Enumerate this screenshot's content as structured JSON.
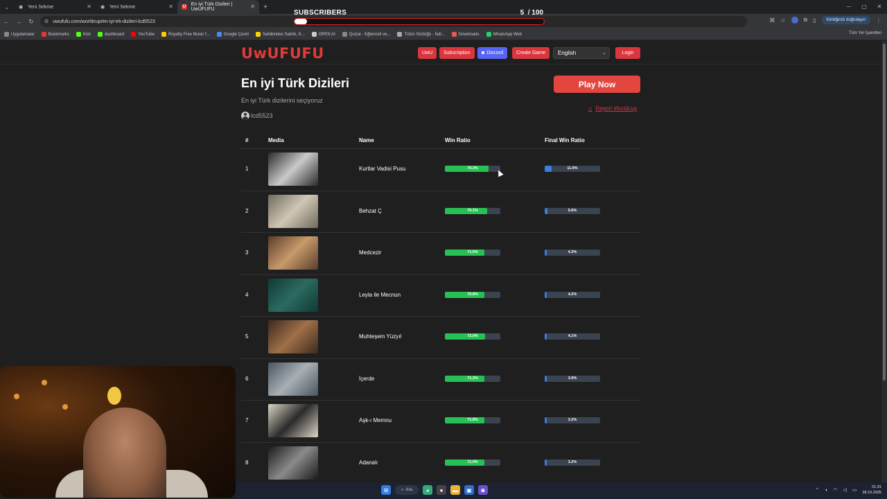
{
  "browser": {
    "tabs": [
      {
        "label": "Yeni Sekme",
        "active": false
      },
      {
        "label": "Yeni Sekme",
        "active": false
      },
      {
        "label": "En iyi Türk Dizileri | UwUFUFU",
        "active": true
      }
    ],
    "url": "uwufufu.com/worldcup/en-iyi-trk-dizileri-lcd5523",
    "profile_button": "Kimliğinizi doğrulayın",
    "bookmarks": [
      "Uygulamalar",
      "Bookmarks",
      "Kick",
      "dashboard",
      "YouTube",
      "Royalty Free Music f...",
      "Google Çeviri",
      "Sahibinden Satılık, K...",
      "OPEN AI",
      "Quizai - Eğlenceli ve...",
      "Tütün Sözlüğü - İlati...",
      "Downloads",
      "WhatsApp Web"
    ],
    "bookmarks_right": "Tüm Yer İşaretleri"
  },
  "overlay": {
    "title": "SUBSCRIBERS",
    "current": "5",
    "goal": "/ 100",
    "progress": 0.05
  },
  "site": {
    "logo": "UwUFUFU",
    "nav": {
      "uwu": "UwU",
      "subscription": "Subscription",
      "discord": "Discord",
      "create_game": "Create Game",
      "language": "English",
      "login": "Login"
    }
  },
  "worldcup": {
    "title": "En iyi Türk Dizileri",
    "description": "En iyi Türk dizilerini seçiyoruz",
    "author": "lcd5523",
    "play_button": "Play Now",
    "report_link": "Report Worldcup"
  },
  "table": {
    "headers": {
      "rank": "#",
      "media": "Media",
      "name": "Name",
      "win_ratio": "Win Ratio",
      "final_win_ratio": "Final Win Ratio"
    },
    "rows": [
      {
        "rank": "1",
        "name": "Kurtlar Vadisi Pusu",
        "win": 79.3,
        "win_label": "79.3%",
        "final": 11.9,
        "final_label": "11.9%"
      },
      {
        "rank": "2",
        "name": "Behzat Ç",
        "win": 76.1,
        "win_label": "76.1%",
        "final": 5.6,
        "final_label": "5.6%"
      },
      {
        "rank": "3",
        "name": "Medcezir",
        "win": 71.6,
        "win_label": "71.6%",
        "final": 4.3,
        "final_label": "4.3%"
      },
      {
        "rank": "4",
        "name": "Leyla ile Mecnun",
        "win": 70.8,
        "win_label": "70.8%",
        "final": 4.2,
        "final_label": "4.2%"
      },
      {
        "rank": "5",
        "name": "Muhteşem Yüzyıl",
        "win": 72.0,
        "win_label": "72.0%",
        "final": 4.1,
        "final_label": "4.1%"
      },
      {
        "rank": "6",
        "name": "İçerde",
        "win": 71.2,
        "win_label": "71.2%",
        "final": 3.9,
        "final_label": "3.9%"
      },
      {
        "rank": "7",
        "name": "Aşk-ı Memnu",
        "win": 71.8,
        "win_label": "71.8%",
        "final": 3.2,
        "final_label": "3.2%"
      },
      {
        "rank": "8",
        "name": "Adanalı",
        "win": 71.0,
        "win_label": "71.0%",
        "final": 3.2,
        "final_label": "3.2%"
      }
    ]
  },
  "taskbar": {
    "search_label": "Ara",
    "time": "01:31",
    "date": "28.10.2025"
  }
}
